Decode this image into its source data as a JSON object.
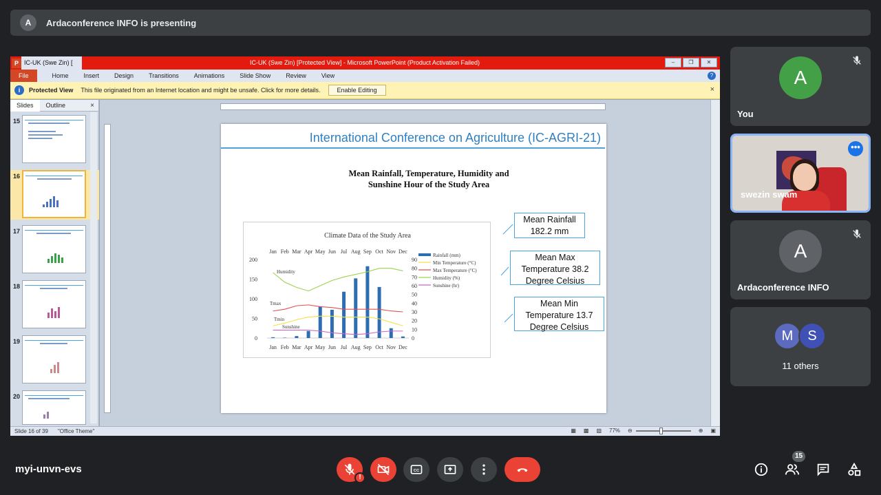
{
  "presenting": {
    "avatar_letter": "A",
    "text": "Ardaconference INFO is presenting"
  },
  "ppt": {
    "logo": "P",
    "quick_access": "IC-UK (Swe Zin) [",
    "window_title": "IC-UK (Swe Zin) [Protected View] - Microsoft PowerPoint (Product Activation Failed)",
    "ribbon_file": "File",
    "ribbon_tabs": [
      "Home",
      "Insert",
      "Design",
      "Transitions",
      "Animations",
      "Slide Show",
      "Review",
      "View"
    ],
    "help": "?",
    "protected_label": "Protected View",
    "protected_message": "This file originated from an Internet location and might be unsafe. Click for more details.",
    "enable_editing": "Enable Editing",
    "close_glyph": "×",
    "panel_tabs": [
      "Slides",
      "Outline"
    ],
    "thumb_numbers": [
      "15",
      "16",
      "17",
      "18",
      "19",
      "20"
    ],
    "status_slide": "Slide 16 of 39",
    "status_theme": "\"Office Theme\"",
    "zoom": "77%"
  },
  "slide": {
    "header": "International Conference on Agriculture (IC-AGRI-21)",
    "title_line1": "Mean Rainfall, Temperature, Humidity  and",
    "title_line2": "Sunshine Hour of the Study Area",
    "callouts": [
      {
        "line1": "Mean Rainfall",
        "line2": "182.2 mm",
        "line3": ""
      },
      {
        "line1": "Mean Max",
        "line2": "Temperature 38.2",
        "line3": "Degree Celsius"
      },
      {
        "line1": "Mean Min",
        "line2": "Temperature 13.7",
        "line3": "Degree Celsius"
      }
    ]
  },
  "chart_data": {
    "type": "bar",
    "title": "Climate Data of the Study Area",
    "categories": [
      "Jan",
      "Feb",
      "Mar",
      "Apr",
      "May",
      "Jun",
      "Jul",
      "Aug",
      "Sep",
      "Oct",
      "Nov",
      "Dec"
    ],
    "ylim_left": [
      0,
      200
    ],
    "yticks_left": [
      "200",
      "150",
      "100",
      "50",
      "0"
    ],
    "ylim_right": [
      0,
      90
    ],
    "yticks_right": [
      "90",
      "80",
      "70",
      "60",
      "50",
      "40",
      "30",
      "20",
      "10",
      "0"
    ],
    "annotations": [
      "Humidity",
      "Tmax",
      "Tmin",
      "Sunshine"
    ],
    "series": [
      {
        "name": "Rainfall (mm)",
        "kind": "bar",
        "axis": "left",
        "color": "#2e6db4",
        "values": [
          2,
          1,
          5,
          18,
          80,
          72,
          118,
          152,
          183,
          130,
          25,
          4
        ]
      },
      {
        "name": "Min Temperature (°C)",
        "kind": "line",
        "axis": "right",
        "color": "#f2e24a",
        "values": [
          14,
          17,
          21,
          24,
          25,
          25,
          24,
          24,
          24,
          22,
          18,
          14
        ]
      },
      {
        "name": "Max Temperature (°C)",
        "kind": "line",
        "axis": "right",
        "color": "#e0504d",
        "values": [
          31,
          33,
          37,
          38,
          36,
          35,
          33,
          33,
          33,
          33,
          31,
          30
        ]
      },
      {
        "name": "Humidity (%)",
        "kind": "line",
        "axis": "right",
        "color": "#9ad34e",
        "values": [
          75,
          64,
          58,
          54,
          60,
          66,
          70,
          73,
          76,
          80,
          80,
          77
        ]
      },
      {
        "name": "Sunshine (hr)",
        "kind": "line",
        "axis": "right",
        "color": "#cf65c8",
        "values": [
          9,
          9,
          9,
          9,
          8,
          6,
          5,
          4,
          5,
          7,
          8,
          8
        ]
      }
    ],
    "legend": "right"
  },
  "participants": {
    "you": {
      "letter": "A",
      "name": "You",
      "color": "#43a047"
    },
    "swezin": {
      "name": "swezin swam",
      "more": "•••"
    },
    "arda": {
      "letter": "A",
      "name": "Ardaconference INFO",
      "color": "#5f6368"
    },
    "others": {
      "letters": [
        "M",
        "S"
      ],
      "colors": [
        "#5c6bc0",
        "#3f51b5"
      ],
      "label": "11 others"
    }
  },
  "footer": {
    "meeting_code": "myi-unvn-evs",
    "mic_warning": "!",
    "people_count": "15"
  }
}
